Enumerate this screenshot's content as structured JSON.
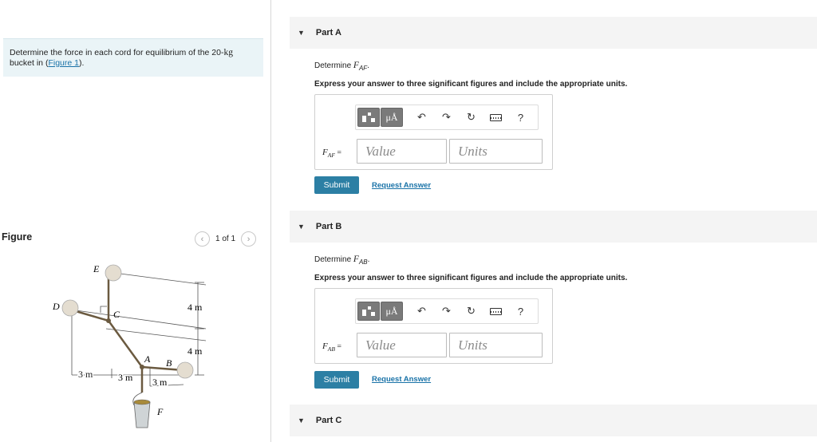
{
  "problem": {
    "text_before": "Determine the force in each cord for equilibrium of the 20-",
    "unit": "kg",
    "text_after": " bucket in (",
    "link": "Figure 1",
    "text_end": ")."
  },
  "figure": {
    "heading": "Figure",
    "pager_text": "1 of 1",
    "prev_icon": "chevron-left-icon",
    "next_icon": "chevron-right-icon",
    "labels": {
      "E": "E",
      "D": "D",
      "C": "C",
      "A": "A",
      "B": "B",
      "F": "F",
      "dim_4m_top": "4 m",
      "dim_4m_bottom": "4 m",
      "dim_3m_left": "3 m",
      "dim_3m_mid": "3 m",
      "dim_3m_right": "3 m"
    }
  },
  "parts": [
    {
      "title": "Part A",
      "prompt_prefix": "Determine ",
      "var": "F",
      "sub": "AF",
      "prompt_suffix": ".",
      "instructions": "Express your answer to three significant figures and include the appropriate units.",
      "value_placeholder": "Value",
      "units_placeholder": "Units",
      "submit_label": "Submit",
      "request_label": "Request Answer"
    },
    {
      "title": "Part B",
      "prompt_prefix": "Determine ",
      "var": "F",
      "sub": "AB",
      "prompt_suffix": ".",
      "instructions": "Express your answer to three significant figures and include the appropriate units.",
      "value_placeholder": "Value",
      "units_placeholder": "Units",
      "submit_label": "Submit",
      "request_label": "Request Answer"
    },
    {
      "title": "Part C"
    }
  ],
  "toolbar": {
    "mu_label": "μÅ",
    "help_label": "?",
    "icons": [
      "templates-icon",
      "units-icon",
      "undo-icon",
      "redo-icon",
      "reset-icon",
      "keyboard-icon",
      "help-icon"
    ]
  },
  "equals": " ="
}
